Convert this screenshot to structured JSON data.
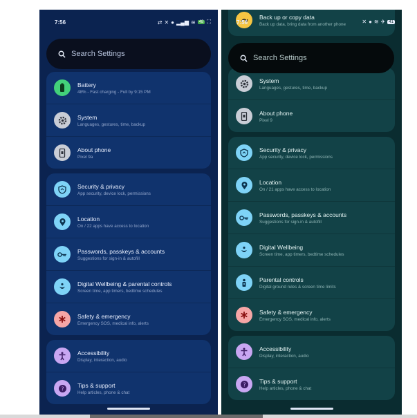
{
  "left": {
    "status_time": "7:56",
    "status_battery": "48",
    "search_placeholder": "Search Settings",
    "groups": [
      {
        "items": [
          {
            "title": "Battery",
            "subtitle": "48% - Fast charging - Full by 9:15 PM",
            "icon": "battery-icon",
            "icon_color": "#43d17a"
          },
          {
            "title": "System",
            "subtitle": "Languages, gestures, time, backup",
            "icon": "gear-icon",
            "icon_color": "#c9cdd6"
          },
          {
            "title": "About phone",
            "subtitle": "Pixel 9a",
            "icon": "phone-icon",
            "icon_color": "#c9cdd6"
          }
        ]
      },
      {
        "items": [
          {
            "title": "Security & privacy",
            "subtitle": "App security, device lock, permissions",
            "icon": "shield-icon",
            "icon_color": "#7ed3f7"
          },
          {
            "title": "Location",
            "subtitle": "On / 22 apps have access to location",
            "icon": "location-pin-icon",
            "icon_color": "#7ed3f7"
          },
          {
            "title": "Passwords, passkeys & accounts",
            "subtitle": "Suggestions for sign-in & autofill",
            "icon": "key-icon",
            "icon_color": "#7ed3f7"
          },
          {
            "title": "Digital Wellbeing & parental controls",
            "subtitle": "Screen time, app timers, bedtime schedules",
            "icon": "wellbeing-icon",
            "icon_color": "#7ed3f7"
          },
          {
            "title": "Safety & emergency",
            "subtitle": "Emergency SOS, medical info, alerts",
            "icon": "asterisk-icon",
            "icon_color": "#f6a6a6"
          }
        ]
      },
      {
        "items": [
          {
            "title": "Accessibility",
            "subtitle": "Display, interaction, audio",
            "icon": "accessibility-icon",
            "icon_color": "#c8a6f2"
          },
          {
            "title": "Tips & support",
            "subtitle": "Help articles, phone & chat",
            "icon": "help-icon",
            "icon_color": "#c8a6f2"
          }
        ]
      }
    ]
  },
  "right": {
    "status_time": "7:56",
    "status_battery": "41",
    "search_placeholder": "Search Settings",
    "top_item": {
      "title": "Back up or copy data",
      "subtitle": "Back up data, bring data from another phone",
      "icon": "backup-icon",
      "icon_color": "#f5c542"
    },
    "groups": [
      {
        "items": [
          {
            "title": "System",
            "subtitle": "Languages, gestures, time, backup",
            "icon": "gear-icon",
            "icon_color": "#c9cdd6"
          },
          {
            "title": "About phone",
            "subtitle": "Pixel 9",
            "icon": "phone-icon",
            "icon_color": "#c9cdd6"
          }
        ]
      },
      {
        "items": [
          {
            "title": "Security & privacy",
            "subtitle": "App security, device lock, permissions",
            "icon": "shield-icon",
            "icon_color": "#7ed3f7"
          },
          {
            "title": "Location",
            "subtitle": "On / 21 apps have access to location",
            "icon": "location-pin-icon",
            "icon_color": "#7ed3f7"
          },
          {
            "title": "Passwords, passkeys & accounts",
            "subtitle": "Suggestions for sign-in & autofill",
            "icon": "key-icon",
            "icon_color": "#7ed3f7"
          },
          {
            "title": "Digital Wellbeing",
            "subtitle": "Screen time, app timers, bedtime schedules",
            "icon": "wellbeing-icon",
            "icon_color": "#7ed3f7"
          },
          {
            "title": "Parental controls",
            "subtitle": "Digital ground rules & screen time limits",
            "icon": "parental-icon",
            "icon_color": "#7ed3f7"
          },
          {
            "title": "Safety & emergency",
            "subtitle": "Emergency SOS, medical info, alerts",
            "icon": "asterisk-icon",
            "icon_color": "#f6a6a6"
          }
        ]
      },
      {
        "items": [
          {
            "title": "Accessibility",
            "subtitle": "Display, interaction, audio",
            "icon": "accessibility-icon",
            "icon_color": "#c8a6f2"
          },
          {
            "title": "Tips & support",
            "subtitle": "Help articles, phone & chat",
            "icon": "help-icon",
            "icon_color": "#c8a6f2"
          }
        ]
      }
    ]
  }
}
